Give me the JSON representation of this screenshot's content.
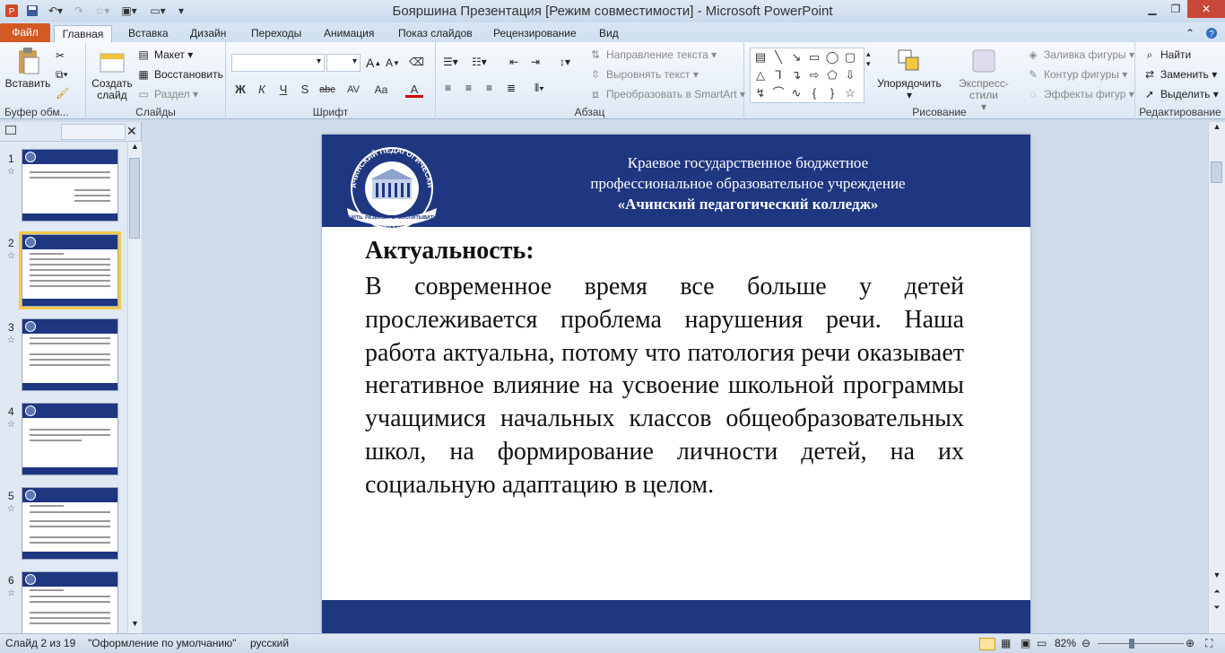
{
  "title_bar": {
    "window_title": "Бояршина Презентация [Режим совместимости]  -  Microsoft PowerPoint",
    "app_icon": "powerpoint-icon",
    "qa_icons": [
      "save-icon",
      "undo-icon",
      "redo-icon",
      "star-icon",
      "layout-icon",
      "blank-icon",
      "customize-icon"
    ]
  },
  "tabs": {
    "file": "Файл",
    "items": [
      "Главная",
      "Вставка",
      "Дизайн",
      "Переходы",
      "Анимация",
      "Показ слайдов",
      "Рецензирование",
      "Вид"
    ]
  },
  "ribbon": {
    "clipboard": {
      "paste": "Вставить",
      "label": "Буфер обм..."
    },
    "slides": {
      "create": "Создать",
      "create2": "слайд",
      "layout": "Макет",
      "reset": "Восстановить",
      "section": "Раздел",
      "label": "Слайды"
    },
    "font": {
      "label": "Шрифт",
      "bold": "Ж",
      "italic": "К",
      "underline": "Ч",
      "shadow": "S",
      "strike": "abc",
      "spacing": "AV",
      "case": "Aa",
      "color": "A",
      "grow": "A",
      "shrink": "A"
    },
    "paragraph": {
      "text_direction": "Направление текста",
      "align_text": "Выровнять текст",
      "smartart": "Преобразовать в SmartArt",
      "label": "Абзац"
    },
    "drawing": {
      "arrange": "Упорядочить",
      "quick_styles": "Экспресс-стили",
      "fill": "Заливка фигуры",
      "outline": "Контур фигуры",
      "effects": "Эффекты фигур",
      "label": "Рисование"
    },
    "editing": {
      "find": "Найти",
      "replace": "Заменить",
      "select": "Выделить",
      "label": "Редактирование"
    }
  },
  "thumbnails": [
    {
      "num": "1",
      "selected": false
    },
    {
      "num": "2",
      "selected": true
    },
    {
      "num": "3",
      "selected": false
    },
    {
      "num": "4",
      "selected": false
    },
    {
      "num": "5",
      "selected": false
    },
    {
      "num": "6",
      "selected": false
    }
  ],
  "slide": {
    "org_line1": "Краевое государственное бюджетное",
    "org_line2": "профессиональное образовательное учреждение",
    "org_line3": "«Ачинский педагогический колледж»",
    "logo_text_top": "АЧИНСКИЙ ПЕДАГОГИЧЕСКИЙ КОЛЛЕДЖ",
    "logo_text_bottom": "УЧИТЬ. РАЗВИВАТЬ. ВОСПИТЫВАТЬ.",
    "logo_year": "основан в 1926г.",
    "heading": "Актуальность:",
    "body": "В современное время все больше у детей прослеживается проблема нарушения речи. Наша работа актуальна, потому что патология речи оказывает негативное влияние на усвоение школьной программы учащимися начальных классов общеобразовательных школ, на формирование личности детей, на их социальную адаптацию в целом."
  },
  "status": {
    "slide_info": "Слайд 2 из 19",
    "theme": "\"Оформление по умолчанию\"",
    "language": "русский",
    "zoom": "82%"
  },
  "colors": {
    "accent": "#1f3681",
    "file_tab": "#d35a22",
    "selection": "#f5c94a"
  }
}
